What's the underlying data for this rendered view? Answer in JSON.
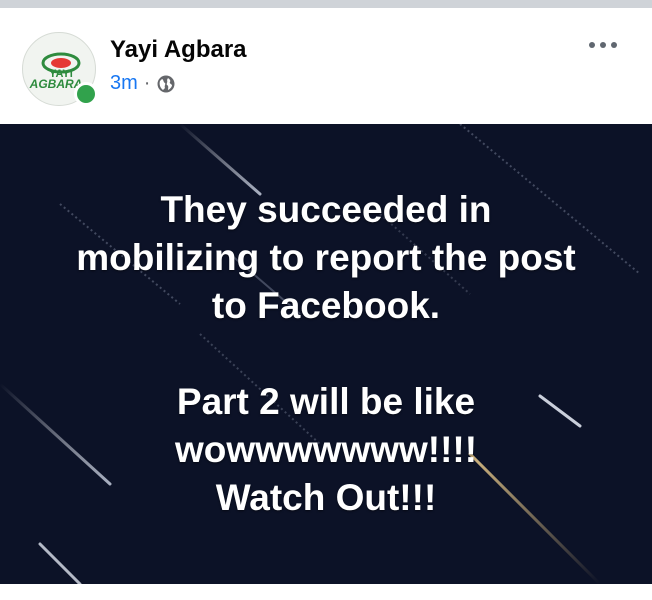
{
  "post": {
    "author": "Yayi Agbara",
    "time": "3m",
    "separator": "·",
    "privacy_icon": "globe-icon",
    "avatar_text": "YAYI AGBARA",
    "online": true,
    "text_lines_1": [
      "They succeeded in",
      "mobilizing to report the post",
      "to Facebook."
    ],
    "text_lines_2": [
      "Part 2 will be like",
      "wowwwwwww!!!!",
      "Watch Out!!!"
    ]
  },
  "colors": {
    "background_card": "#0c1227",
    "time_link": "#1877f2",
    "online": "#31a24c"
  }
}
